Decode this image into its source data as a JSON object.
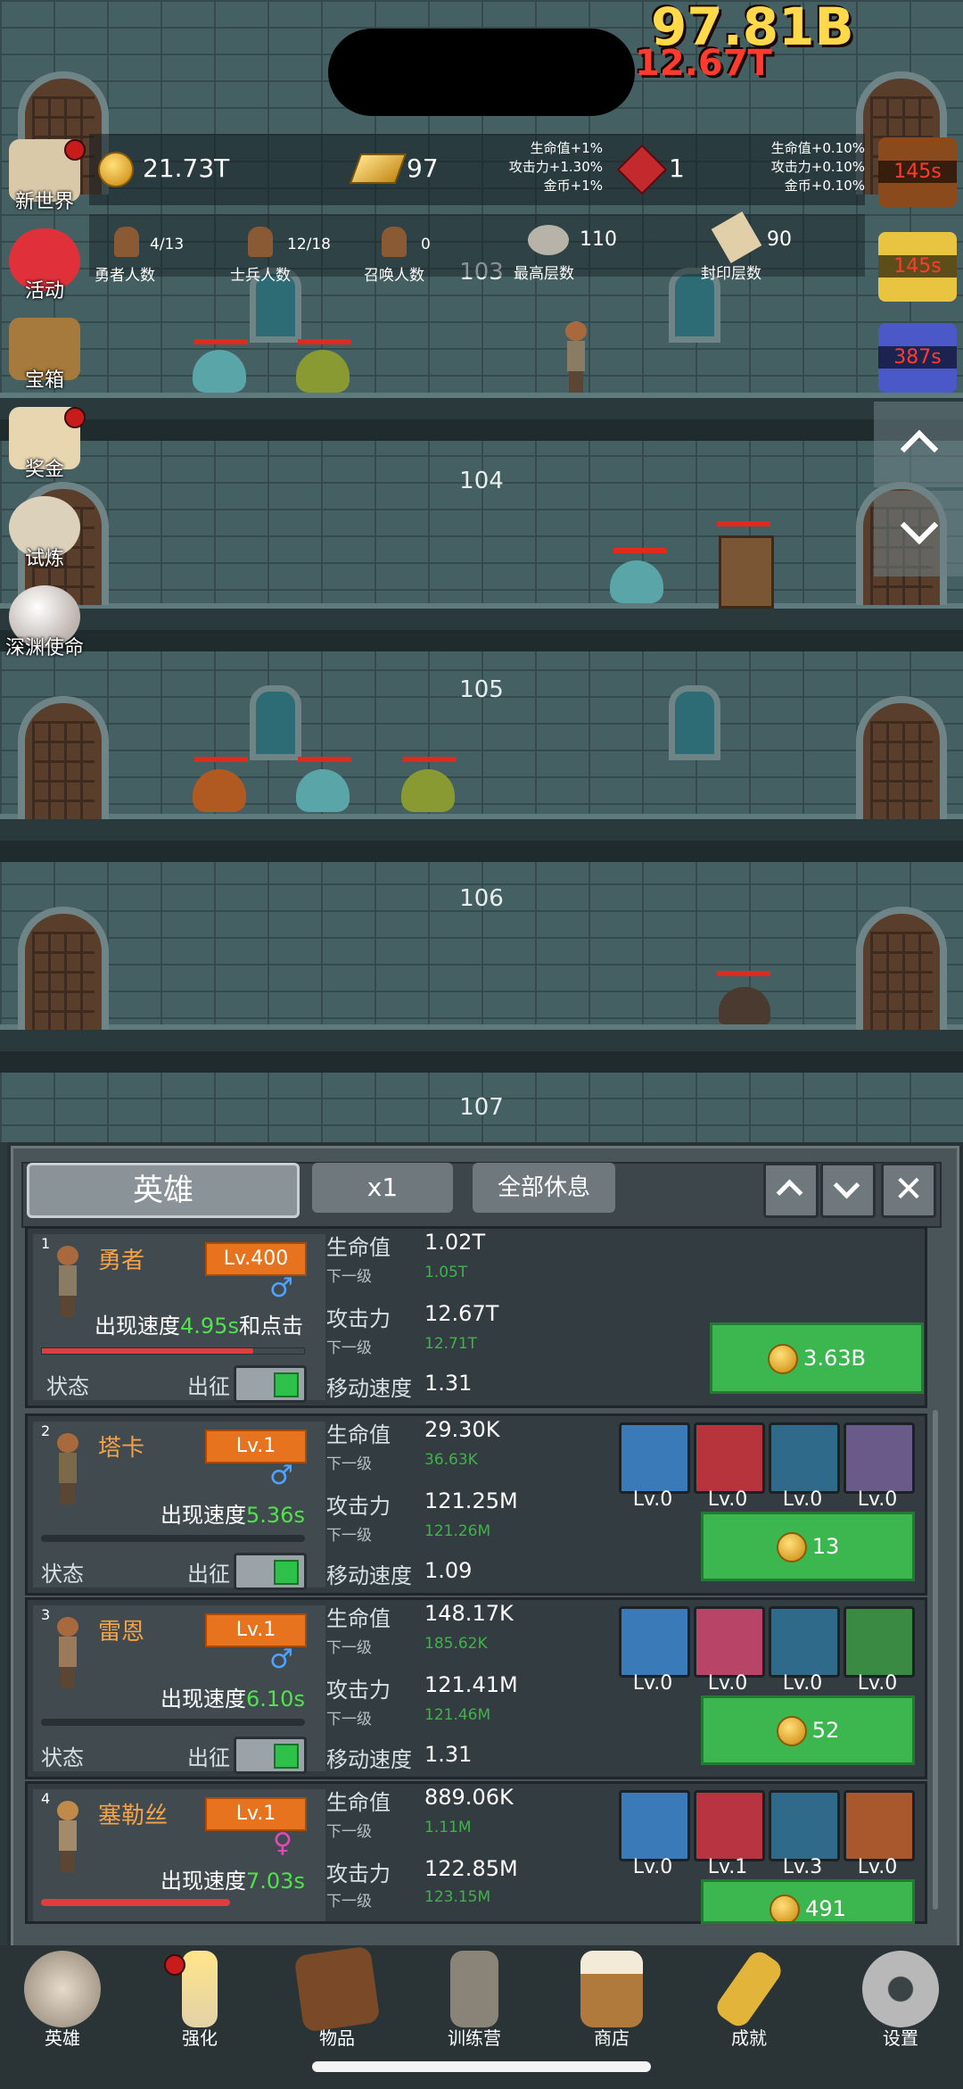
{
  "damage": {
    "total": "97.81B",
    "hit": "12.67T"
  },
  "resources": {
    "gold": "21.73T",
    "gold_bar": "97",
    "gold_bar_bonus": [
      "生命值+1%",
      "攻击力+1.30%",
      "金币+1%"
    ],
    "gem": "1",
    "gem_bonus": [
      "生命值+0.10%",
      "攻击力+0.10%",
      "金币+0.10%"
    ]
  },
  "counts": {
    "brave": {
      "value": "4/13",
      "label": "勇者人数"
    },
    "soldier": {
      "value": "12/18",
      "label": "士兵人数"
    },
    "summon": {
      "value": "0",
      "label": "召唤人数"
    },
    "highest": {
      "value": "110",
      "label": "最高层数"
    },
    "sealed": {
      "value": "90",
      "label": "封印层数"
    }
  },
  "side_menu": [
    "新世界",
    "活动",
    "宝箱",
    "奖金",
    "试炼",
    "深渊使命"
  ],
  "buff_timers": [
    "145s",
    "145s",
    "387s"
  ],
  "floors": [
    "103",
    "104",
    "105",
    "106",
    "107"
  ],
  "tabs": {
    "heroes": "英雄",
    "speed": "x1",
    "rest_all": "全部休息"
  },
  "common": {
    "hp": "生命值",
    "next": "下一级",
    "atk": "攻击力",
    "move": "移动速度",
    "status": "状态",
    "deploy": "出征",
    "appear": "出现速度",
    "and_click": "和点击"
  },
  "heroes": [
    {
      "index": "1",
      "name": "勇者",
      "level": "Lv.400",
      "speed": "4.95s",
      "gender": "♂",
      "hp": "1.02T",
      "hp_next": "1.05T",
      "atk": "12.67T",
      "atk_next": "12.71T",
      "move": "1.31",
      "cost": "3.63B",
      "skills": []
    },
    {
      "index": "2",
      "name": "塔卡",
      "level": "Lv.1",
      "speed": "5.36s",
      "gender": "♂",
      "hp": "29.30K",
      "hp_next": "36.63K",
      "atk": "121.25M",
      "atk_next": "121.26M",
      "move": "1.09",
      "cost": "13",
      "skills": [
        "Lv.0",
        "Lv.0",
        "Lv.0",
        "Lv.0"
      ]
    },
    {
      "index": "3",
      "name": "雷恩",
      "level": "Lv.1",
      "speed": "6.10s",
      "gender": "♂",
      "hp": "148.17K",
      "hp_next": "185.62K",
      "atk": "121.41M",
      "atk_next": "121.46M",
      "move": "1.31",
      "cost": "52",
      "skills": [
        "Lv.0",
        "Lv.0",
        "Lv.0",
        "Lv.0"
      ]
    },
    {
      "index": "4",
      "name": "塞勒丝",
      "level": "Lv.1",
      "speed": "7.03s",
      "gender": "♀",
      "hp": "889.06K",
      "hp_next": "1.11M",
      "atk": "122.85M",
      "atk_next": "123.15M",
      "move": "",
      "cost": "491",
      "skills": [
        "Lv.0",
        "Lv.1",
        "Lv.3",
        "Lv.0"
      ]
    }
  ],
  "nav": [
    "英雄",
    "强化",
    "物品",
    "训练营",
    "商店",
    "成就",
    "设置"
  ],
  "colors": {
    "accent_orange": "#e8731e",
    "green_button": "#3cb74f",
    "speed_green": "#4fe34a",
    "hp_red": "#e02a1e"
  }
}
